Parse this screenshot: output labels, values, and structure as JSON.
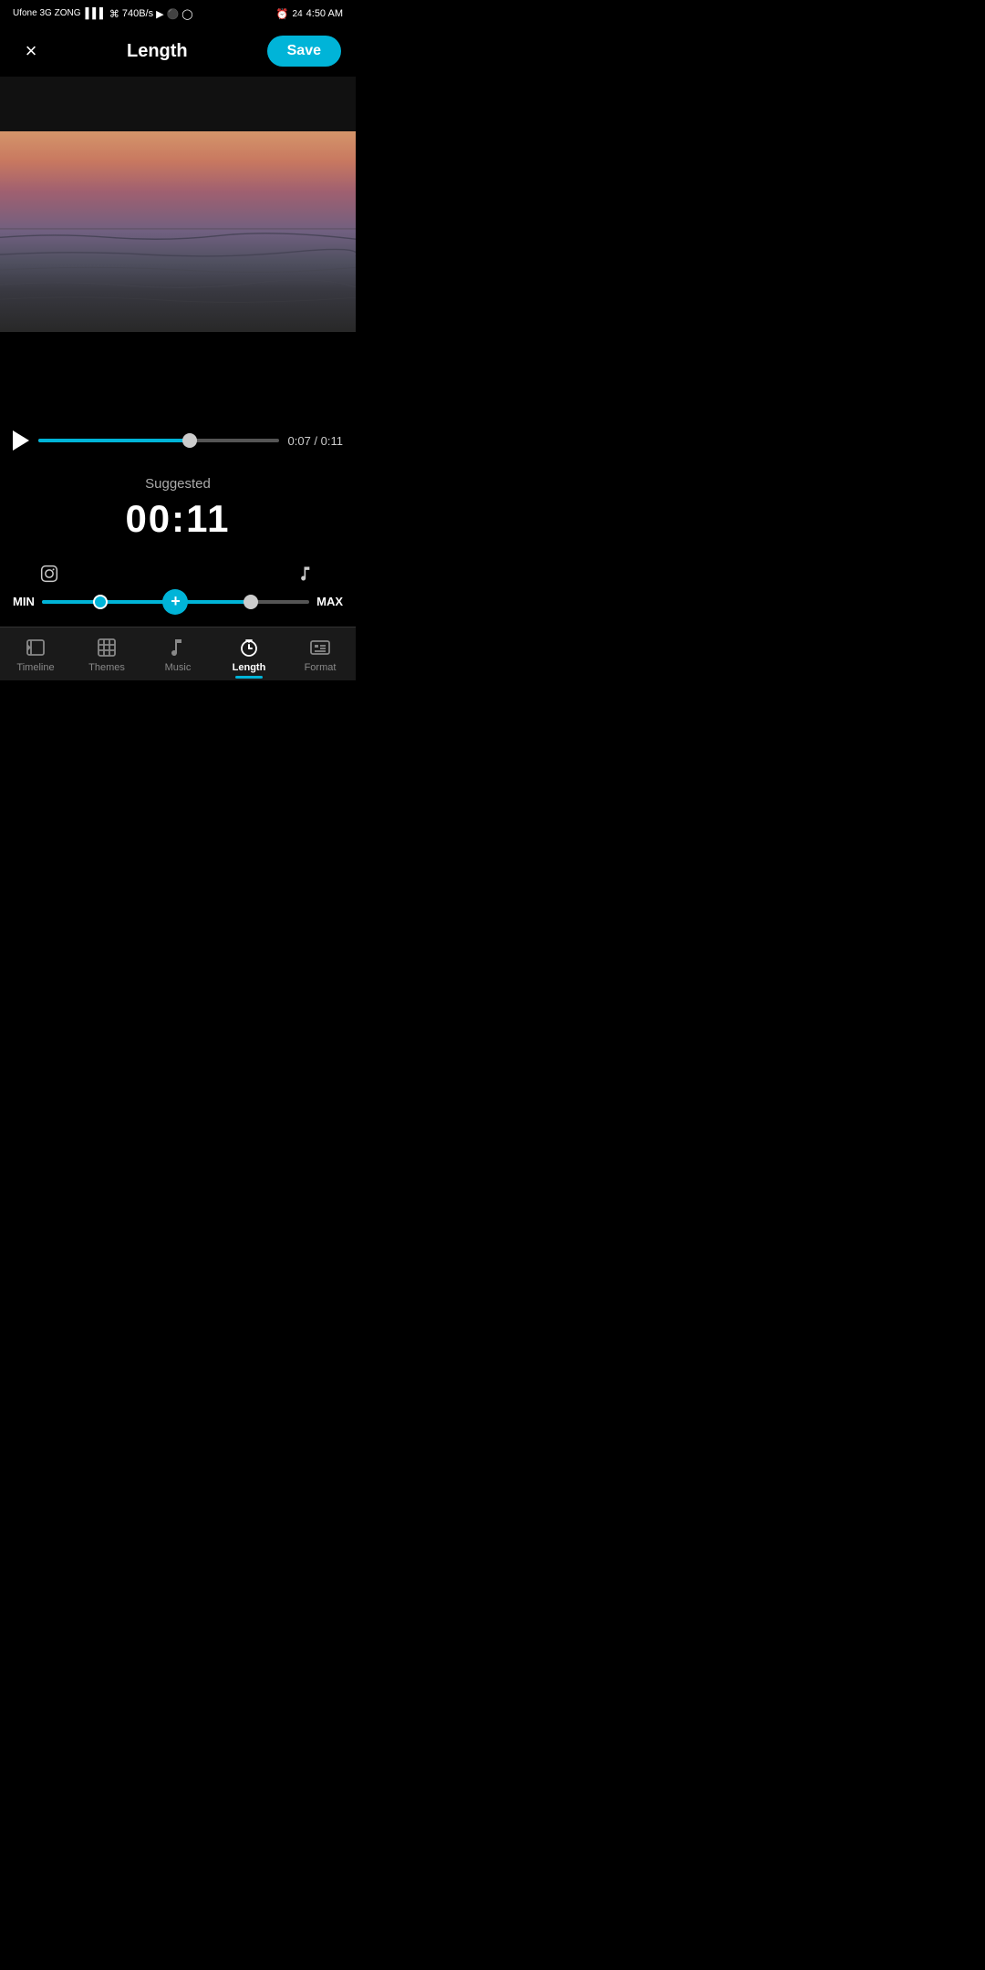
{
  "status": {
    "carrier": "Ufone 3G ZONG",
    "speed": "740B/s",
    "time": "4:50 AM",
    "battery": "24"
  },
  "header": {
    "title": "Length",
    "close_label": "×",
    "save_label": "Save"
  },
  "playback": {
    "current_time": "0:07",
    "total_time": "0:11",
    "time_display": "0:07 / 0:11",
    "progress_percent": 63
  },
  "suggested": {
    "label": "Suggested",
    "time": "00:11"
  },
  "slider": {
    "min_label": "MIN",
    "max_label": "MAX"
  },
  "tabs": [
    {
      "id": "timeline",
      "label": "Timeline",
      "active": false
    },
    {
      "id": "themes",
      "label": "Themes",
      "active": false
    },
    {
      "id": "music",
      "label": "Music",
      "active": false
    },
    {
      "id": "length",
      "label": "Length",
      "active": true
    },
    {
      "id": "format",
      "label": "Format",
      "active": false
    }
  ]
}
